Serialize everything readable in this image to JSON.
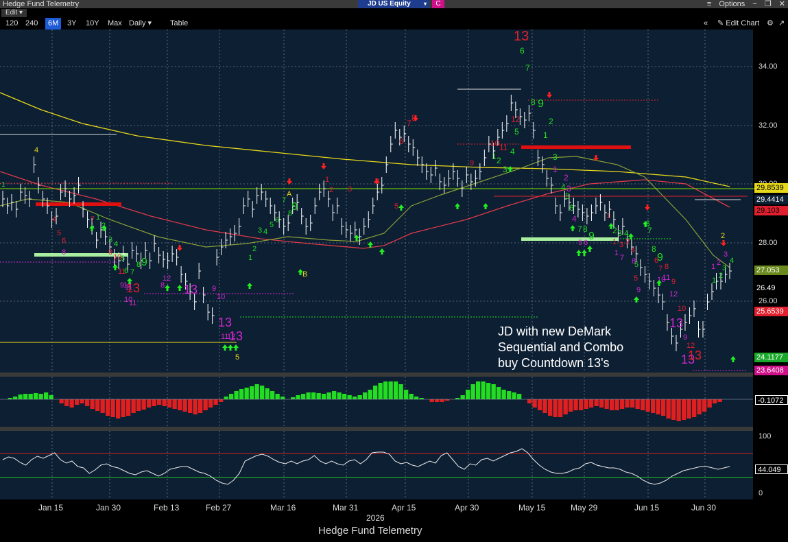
{
  "window": {
    "title": "Hedge Fund Telemetry",
    "ticker": "JD US Equity",
    "c_label": "C",
    "options": "Options"
  },
  "edit_label": "Edit",
  "toolbar": {
    "periods": [
      "120",
      "240",
      "6M",
      "3Y",
      "10Y",
      "Max"
    ],
    "selected": "6M",
    "frequency": "Daily ▾",
    "table": "Table",
    "edit_chart": "Edit Chart"
  },
  "price_axis": [
    "34.00",
    "32.00",
    "30.00",
    "28.00",
    "26.00"
  ],
  "price_tags": [
    {
      "label": "29.8539",
      "bg": "#e8d81a",
      "fg": "#000"
    },
    {
      "label": "29.4414",
      "bg": "#0d1f33",
      "fg": "#ffffff"
    },
    {
      "label": "29.103",
      "bg": "#e0202e",
      "fg": "#000"
    },
    {
      "label": "27.053",
      "bg": "#6a8a1e",
      "fg": "#fff"
    },
    {
      "label": "26.49",
      "bg": "#000000",
      "fg": "#ffffff"
    },
    {
      "label": "25.6539",
      "bg": "#e0202e",
      "fg": "#fff"
    },
    {
      "label": "24.1177",
      "bg": "#1aa82a",
      "fg": "#fff"
    },
    {
      "label": "23.6408",
      "bg": "#d0108a",
      "fg": "#fff"
    }
  ],
  "macd_label": "-0.1072",
  "rsi_axis": [
    "100",
    "0"
  ],
  "rsi_label": "44.049",
  "x_axis": [
    "Jan 15",
    "Jan 30",
    "Feb 13",
    "Feb 27",
    "Mar 16",
    "Mar 31",
    "Apr 15",
    "Apr 30",
    "May 15",
    "May 29",
    "Jun 15",
    "Jun 30"
  ],
  "year": "2026",
  "footer": "Hedge Fund Telemetry",
  "annotation": "JD with new DeMark\nSequential and Combo\nbuy Countdown 13's",
  "demark": {
    "big13": "13",
    "sell_counts": [
      "1",
      "2",
      "3",
      "4",
      "5",
      "6",
      "7",
      "8",
      "9",
      "10",
      "11",
      "12"
    ],
    "buy_labels": [
      "9",
      "13"
    ]
  },
  "colors": {
    "panel": "#0d1f33",
    "up": "#22dd22",
    "down": "#e0202e",
    "magenta": "#d028d0",
    "yellow": "#e8d81a",
    "olive": "#7a9a2a"
  }
}
